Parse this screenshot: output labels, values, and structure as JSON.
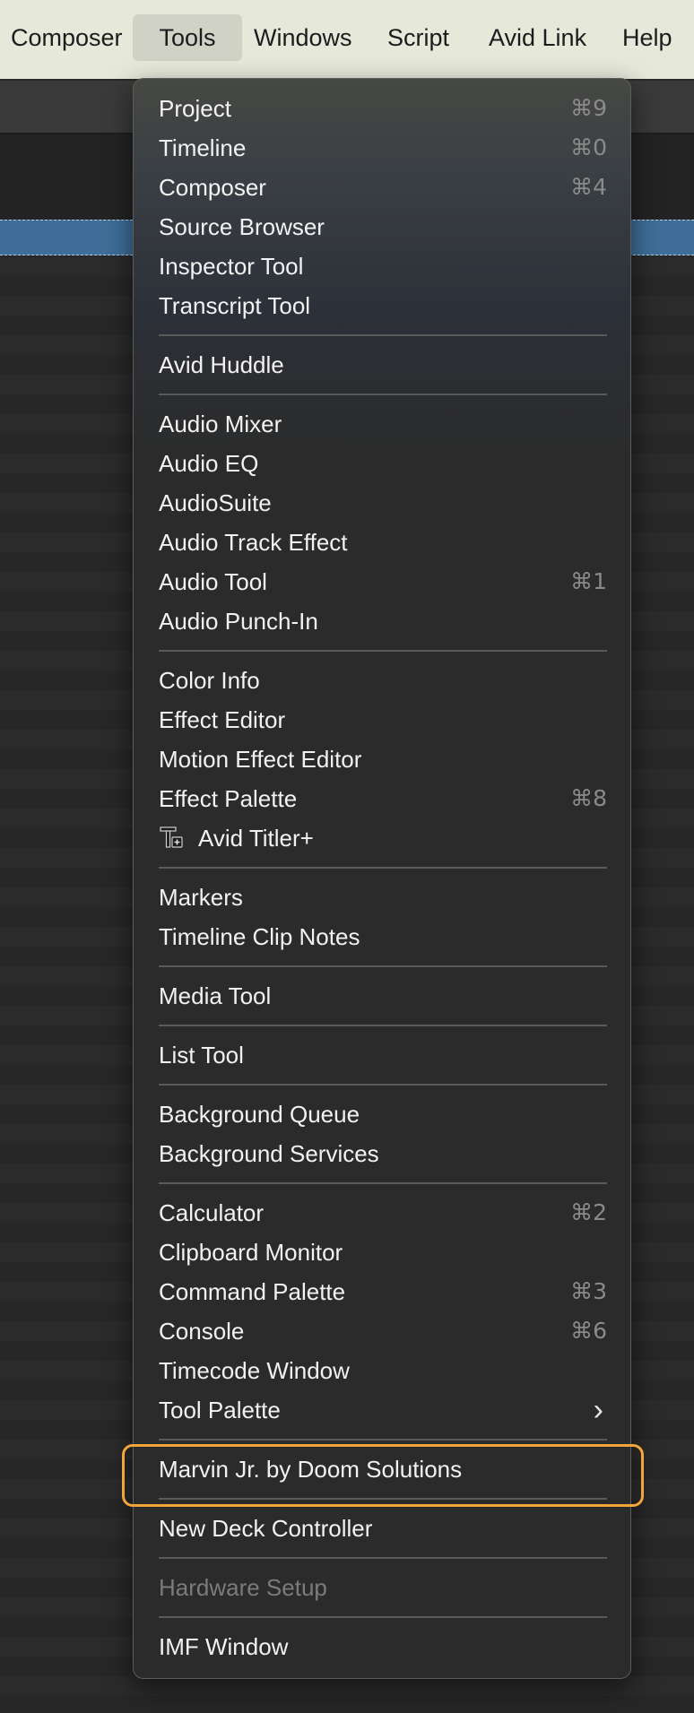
{
  "menubar": {
    "items": [
      {
        "label": "Composer"
      },
      {
        "label": "Tools"
      },
      {
        "label": "Windows"
      },
      {
        "label": "Script"
      },
      {
        "label": "Avid Link"
      },
      {
        "label": "Help"
      }
    ],
    "active": "Tools"
  },
  "tools_menu": {
    "groups": [
      [
        {
          "label": "Project",
          "shortcut": "⌘9"
        },
        {
          "label": "Timeline",
          "shortcut": "⌘0"
        },
        {
          "label": "Composer",
          "shortcut": "⌘4"
        },
        {
          "label": "Source Browser"
        },
        {
          "label": "Inspector Tool"
        },
        {
          "label": "Transcript Tool"
        }
      ],
      [
        {
          "label": "Avid Huddle"
        }
      ],
      [
        {
          "label": "Audio Mixer"
        },
        {
          "label": "Audio EQ"
        },
        {
          "label": "AudioSuite"
        },
        {
          "label": "Audio Track Effect"
        },
        {
          "label": "Audio Tool",
          "shortcut": "⌘1"
        },
        {
          "label": "Audio Punch-In"
        }
      ],
      [
        {
          "label": "Color Info"
        },
        {
          "label": "Effect Editor"
        },
        {
          "label": "Motion Effect Editor"
        },
        {
          "label": "Effect Palette",
          "shortcut": "⌘8"
        },
        {
          "label": "Avid Titler+",
          "icon": "titler-icon"
        }
      ],
      [
        {
          "label": "Markers"
        },
        {
          "label": "Timeline Clip Notes"
        }
      ],
      [
        {
          "label": "Media Tool"
        }
      ],
      [
        {
          "label": "List Tool"
        }
      ],
      [
        {
          "label": "Background Queue"
        },
        {
          "label": "Background Services"
        }
      ],
      [
        {
          "label": "Calculator",
          "shortcut": "⌘2"
        },
        {
          "label": "Clipboard Monitor"
        },
        {
          "label": "Command Palette",
          "shortcut": "⌘3"
        },
        {
          "label": "Console",
          "shortcut": "⌘6"
        },
        {
          "label": "Timecode Window"
        },
        {
          "label": "Tool Palette",
          "submenu": true
        }
      ],
      [
        {
          "label": "Marvin Jr. by Doom Solutions",
          "highlighted": true
        }
      ],
      [
        {
          "label": "New Deck Controller"
        }
      ],
      [
        {
          "label": "Hardware Setup",
          "disabled": true
        }
      ],
      [
        {
          "label": "IMF Window"
        }
      ]
    ],
    "highlight_color": "#f3a53a"
  }
}
